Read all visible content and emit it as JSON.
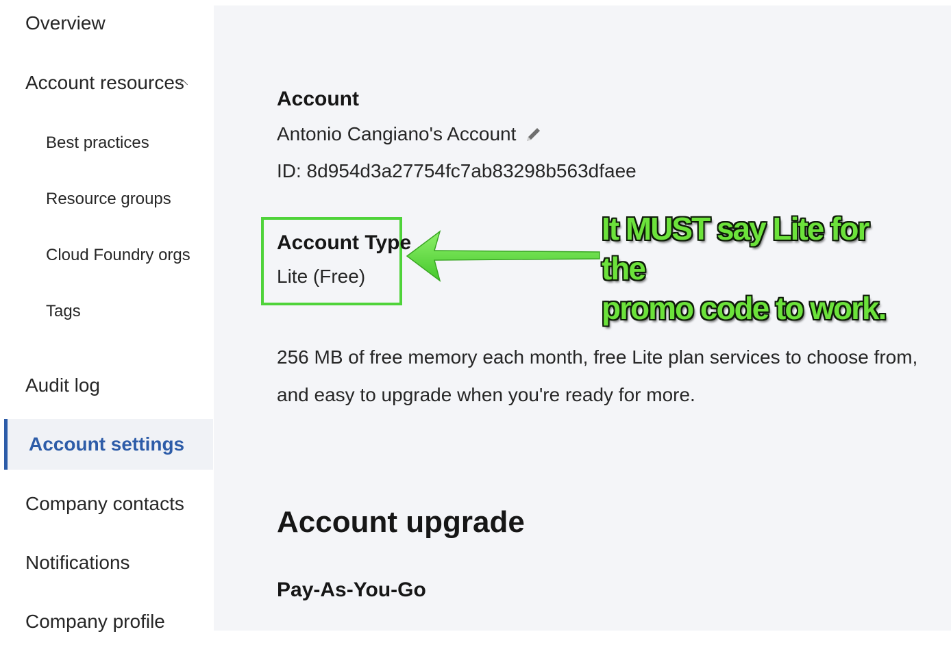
{
  "sidebar": {
    "items": [
      {
        "label": "Overview"
      },
      {
        "label": "Account resources"
      },
      {
        "label": "Best practices"
      },
      {
        "label": "Resource groups"
      },
      {
        "label": "Cloud Foundry orgs"
      },
      {
        "label": "Tags"
      },
      {
        "label": "Audit log"
      },
      {
        "label": "Account settings"
      },
      {
        "label": "Company contacts"
      },
      {
        "label": "Notifications"
      },
      {
        "label": "Company profile"
      }
    ],
    "active_item": "Account settings"
  },
  "account": {
    "label": "Account",
    "name": "Antonio Cangiano's Account",
    "id": "ID: 8d954d3a27754fc7ab83298b563dfaee",
    "edit_icon": "pencil-icon"
  },
  "account_type": {
    "label": "Account Type",
    "value": "Lite (Free)"
  },
  "annotation": {
    "line1": "It MUST say Lite for the",
    "line2": "promo code to work.",
    "color": "#4fd33a"
  },
  "description": "256 MB of free memory each month, free Lite plan services to choose from, and easy to upgrade when you're ready for more.",
  "upgrade": {
    "title": "Account upgrade",
    "plan": "Pay-As-You-Go"
  },
  "colors": {
    "accent": "#2d5ca8",
    "main_bg": "#f4f5f8",
    "highlight": "#4fd33a"
  }
}
